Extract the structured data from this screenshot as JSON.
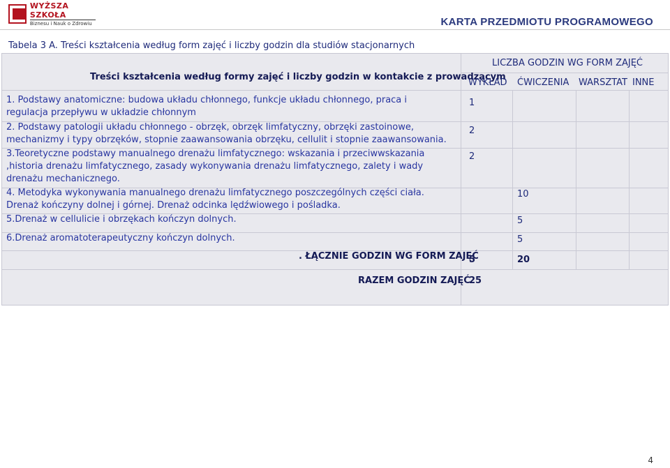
{
  "header": {
    "logo_line1": "WYŻSZA SZKOŁA",
    "logo_line2": "Biznesu i Nauk o Zdrowiu",
    "title": "KARTA PRZEDMIOTU PROGRAMOWEGO"
  },
  "caption": "Tabela 3 A. Treści kształcenia według form zajęć i liczby godzin dla studiów stacjonarnych",
  "table": {
    "left_header": "Treści kształcenia według formy zajęć i liczby godzin w kontakcie z prowadzącym",
    "group_header": "LICZBA GODZIN WG FORM ZAJĘĆ",
    "columns": [
      "WYKŁAD",
      "ĆWICZENIA",
      "WARSZTAT",
      "INNE"
    ],
    "rows": [
      {
        "text": "1. Podstawy anatomiczne: budowa układu chłonnego, funkcje układu chłonnego, praca i regulacja przepływu w układzie chłonnym",
        "value": "1"
      },
      {
        "text": "2. Podstawy patologii układu chłonnego - obrzęk, obrzęk limfatyczny, obrzęki zastoinowe, mechanizmy i typy obrzęków, stopnie zaawansowania obrzęku, cellulit i stopnie zaawansowania.",
        "value": "2"
      },
      {
        "text": "3.Teoretyczne podstawy manualnego drenażu limfatycznego: wskazania i przeciwwskazania ,historia drenażu limfatycznego, zasady wykonywania drenażu limfatycznego, zalety i wady drenażu mechanicznego.",
        "value": "2"
      },
      {
        "text": "4. Metodyka wykonywania manualnego drenażu limfatycznego poszczególnych części ciała. Drenaż kończyny dolnej i górnej. Drenaż odcinka lędźwiowego i pośladka.",
        "value": "10"
      },
      {
        "text": "5.Drenaż w cellulicie i obrzękach kończyn dolnych.",
        "value": "5"
      },
      {
        "text": "6.Drenaż aromatoterapeutyczny kończyn dolnych.",
        "value": "5"
      }
    ],
    "total_label": ". ŁĄCZNIE GODZIN WG FORM ZAJĘĆ",
    "total_wyklad": "5",
    "total_cwiczenia": "20",
    "grand_label": "RAZEM GODZIN ZAJĘĆ",
    "grand_value": "25"
  },
  "page_number": "4"
}
